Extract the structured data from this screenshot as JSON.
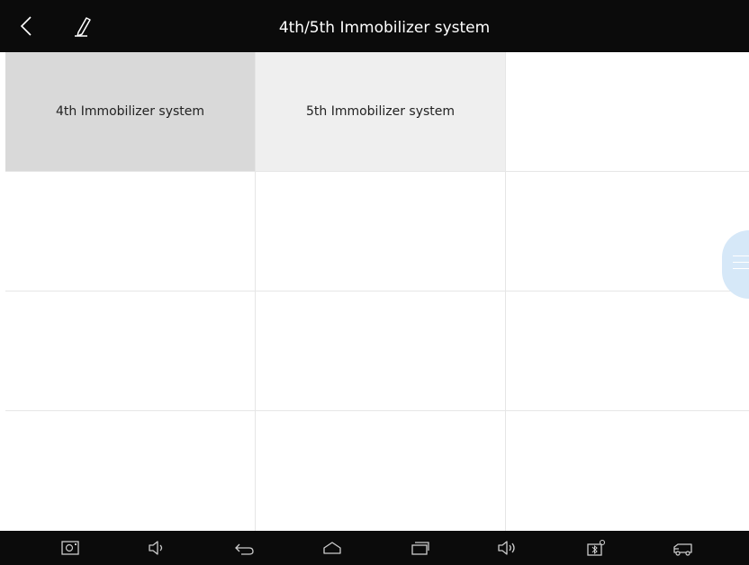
{
  "header": {
    "title": "4th/5th Immobilizer system",
    "back_icon": "chevron-left-icon",
    "edit_icon": "pencil-icon"
  },
  "menu": {
    "items": [
      {
        "label": "4th Immobilizer system",
        "selected": true
      },
      {
        "label": "5th Immobilizer system",
        "selected": false
      }
    ]
  },
  "floating_button": {
    "icon": "menu-lines-icon"
  },
  "navbar": {
    "icons": [
      "screenshot-icon",
      "volume-down-icon",
      "back-icon",
      "home-icon",
      "recent-apps-icon",
      "volume-up-icon",
      "bluetooth-vci-icon",
      "truck-icon"
    ]
  },
  "colors": {
    "topbar": "#0b0b0b",
    "selected_cell": "#d9d9d9",
    "unselected_cell": "#efefef",
    "floating_button": "#d6e8f8"
  }
}
